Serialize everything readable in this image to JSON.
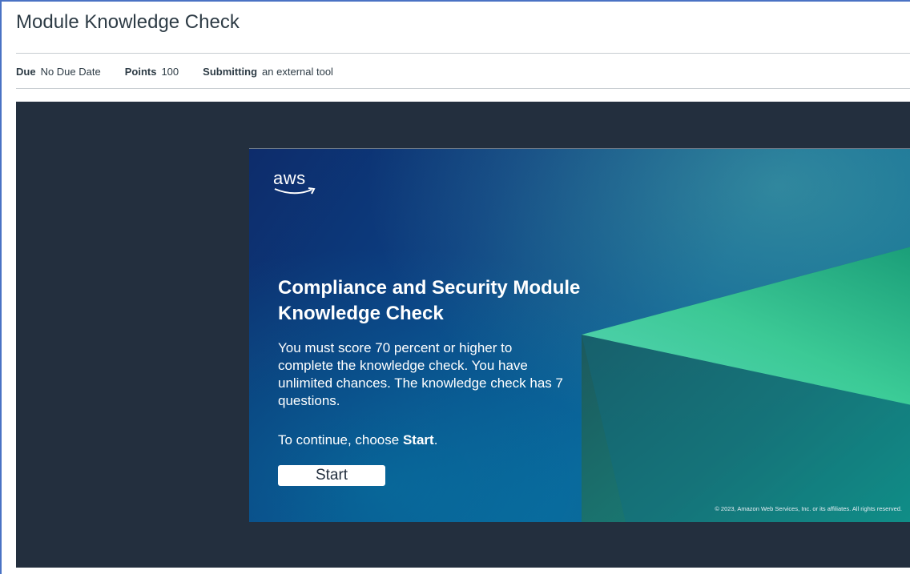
{
  "header": {
    "title": "Module Knowledge Check"
  },
  "details": {
    "due_label": "Due",
    "due_value": "No Due Date",
    "points_label": "Points",
    "points_value": "100",
    "submitting_label": "Submitting",
    "submitting_value": "an external tool"
  },
  "card": {
    "logo_text": "aws",
    "title": "Compliance and Security Module Knowledge Check",
    "description": "You must score 70 percent or higher to complete the knowledge check. You have unlimited chances. The knowledge check has 7 questions.",
    "continue_prefix": "To continue, choose ",
    "continue_bold": "Start",
    "continue_suffix": ".",
    "start_button": "Start",
    "copyright": "© 2023, Amazon Web Services, Inc. or its affiliates. All rights reserved."
  },
  "colors": {
    "frame_bg": "#232f3e",
    "accent_green": "#3fe0a0",
    "border_blue": "#4a72c4"
  }
}
